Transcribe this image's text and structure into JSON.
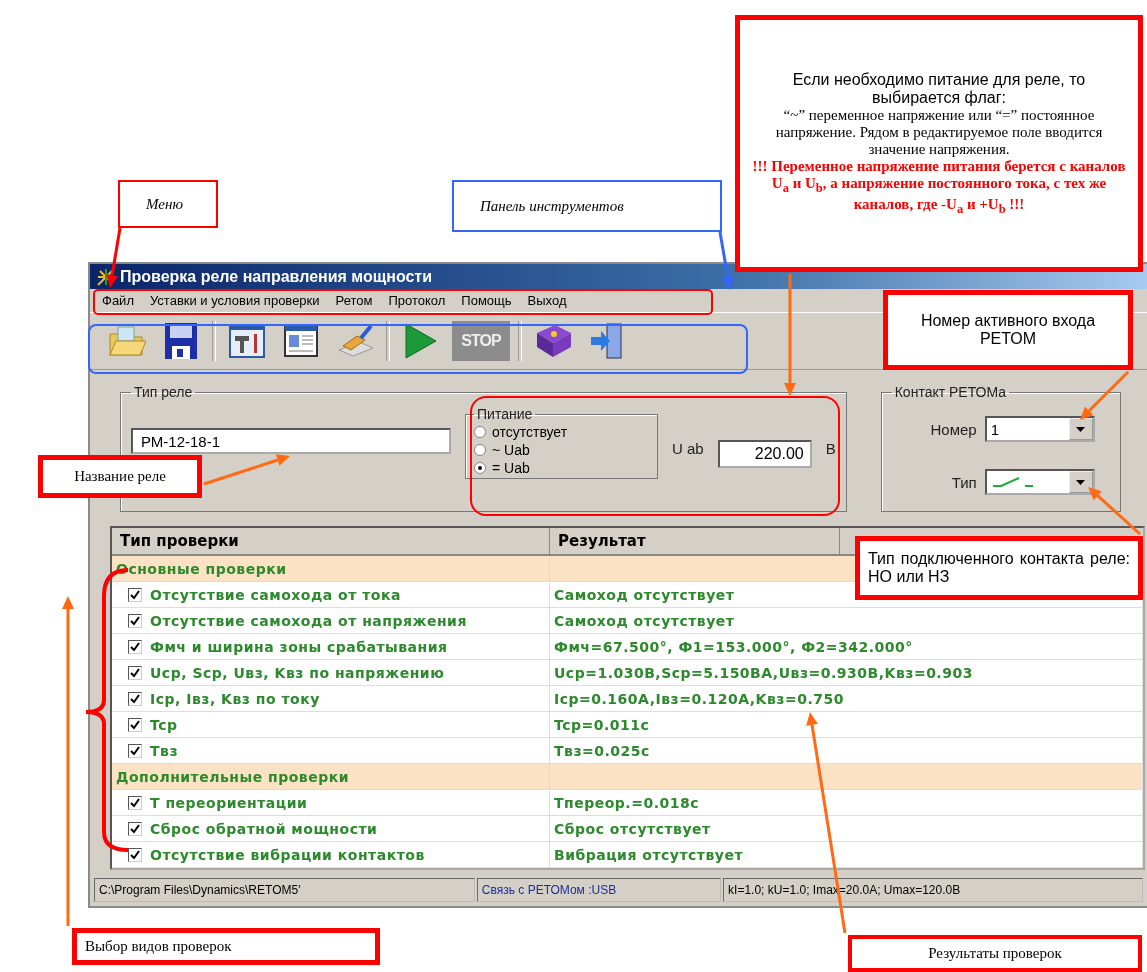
{
  "window": {
    "title": "Проверка реле направления мощности"
  },
  "menu": [
    "Файл",
    "Уставки и условия проверки",
    "Ретом",
    "Протокол",
    "Помощь",
    "Выход"
  ],
  "toolbar": {
    "stop_label": "STOP"
  },
  "relay_type": {
    "legend": "Тип реле",
    "value": "РМ-12-18-1"
  },
  "power": {
    "legend": "Питание",
    "options": [
      {
        "label": "отсутствует",
        "selected": false
      },
      {
        "label": "~ Uab",
        "selected": false
      },
      {
        "label": "= Uab",
        "selected": true
      }
    ],
    "voltage_label": "U ab",
    "voltage": "220.00",
    "unit": "В"
  },
  "contact": {
    "legend": "Контакт РЕТОМа",
    "number_label": "Номер",
    "number": "1",
    "type_label": "Тип"
  },
  "table": {
    "columns": [
      "Тип проверки",
      "Результат"
    ],
    "rows": [
      {
        "kind": "group",
        "label": "Основные проверки"
      },
      {
        "kind": "check",
        "label": "Отсутствие самохода от тока",
        "checked": true,
        "result": "Самоход отсутствует"
      },
      {
        "kind": "check",
        "label": "Отсутствие самохода от напряжения",
        "checked": true,
        "result": "Самоход отсутствует"
      },
      {
        "kind": "check",
        "label": "Фмч и ширина зоны срабатывания",
        "checked": true,
        "result": "Фмч=67.500°, Ф1=153.000°, Ф2=342.000°"
      },
      {
        "kind": "check",
        "label": "Ucp, Scp, Uвз, Kвз по напряжению",
        "checked": true,
        "result": "Ucp=1.030B,Scp=5.150BA,Uвз=0.930B,Kвз=0.903"
      },
      {
        "kind": "check",
        "label": "Icp, Iвз, Kвз по току",
        "checked": true,
        "result": "Icp=0.160A,Iвз=0.120A,Kвз=0.750"
      },
      {
        "kind": "check",
        "label": "Tcp",
        "checked": true,
        "result": "Tcp=0.011c"
      },
      {
        "kind": "check",
        "label": "Tвз",
        "checked": true,
        "result": "Tвз=0.025c"
      },
      {
        "kind": "group",
        "label": "Дополнительные проверки"
      },
      {
        "kind": "check",
        "label": "T переориентации",
        "checked": true,
        "result": "Tпереор.=0.018c"
      },
      {
        "kind": "check",
        "label": "Сброс обратной мощности",
        "checked": true,
        "result": "Сброс отсутствует"
      },
      {
        "kind": "check",
        "label": "Отсутствие вибрации контактов",
        "checked": true,
        "result": "Вибрация отсутствует"
      }
    ]
  },
  "status_bar": [
    "C:\\Program Files\\Dynamics\\RETOM5'",
    "Связь с РЕТОМом :USB",
    "kI=1.0; kU=1.0; Imax=20.0A; Umax=120.0B"
  ],
  "annotations": [
    {
      "color": "#ff0000",
      "parts": [
        {
          "kind": "italic",
          "text": "Меню"
        }
      ]
    },
    {
      "color": "#3366ff",
      "parts": [
        {
          "kind": "italic",
          "text": "Панель инструментов"
        }
      ]
    },
    {
      "color": "#ff0000",
      "parts": [
        {
          "kind": "sans",
          "text": "Если необходимо питание для реле, то выбирается флаг:"
        },
        {
          "kind": "serif",
          "text": "“~” переменное напряжение или “=” постоянное напряжение. Рядом в редактируемое поле вводится значение напряжения."
        },
        {
          "kind": "warning",
          "text": "!!!  Переменное напряжение питания берется с каналов U$_{a}$ и U$_{b}$, а напряжение постоянного тока, с  тех же каналов, где -U$_{a}$ и +U$_{b}$ !!!"
        }
      ]
    },
    {
      "color": "#ff0000",
      "parts": [
        {
          "kind": "sans",
          "text": "Номер активного входа РЕТОМ"
        }
      ]
    },
    {
      "color": "#ff0000",
      "parts": [
        {
          "kind": "serif",
          "text": "Название реле"
        }
      ]
    },
    {
      "color": "#ff0000",
      "parts": [
        {
          "kind": "justify",
          "text": "Тип подключенного контакта реле: НО или НЗ"
        }
      ]
    },
    {
      "color": "#ff0000",
      "parts": [
        {
          "kind": "serif",
          "text": "Выбор видов проверок"
        }
      ]
    },
    {
      "color": "#ff0000",
      "parts": [
        {
          "kind": "serif",
          "text": "Результаты проверок"
        }
      ]
    }
  ]
}
